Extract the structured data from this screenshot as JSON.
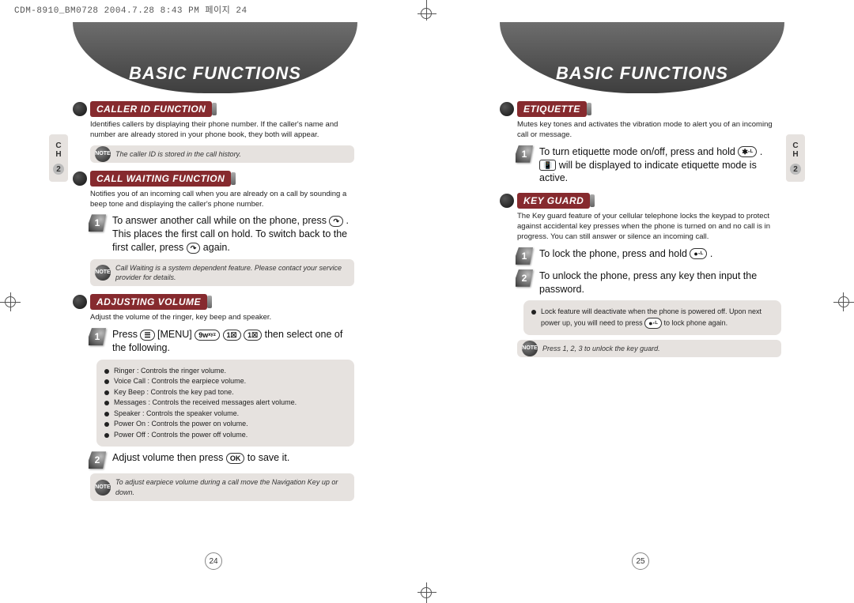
{
  "meta_header": "CDM-8910_BM0728  2004.7.28 8:43 PM 페이지 24",
  "banner_title": "BASIC FUNCTIONS",
  "sidebar": {
    "ch": "C\nH",
    "chapter": "2"
  },
  "pages": {
    "left": "24",
    "right": "25"
  },
  "left": {
    "caller_id": {
      "title": "CALLER ID FUNCTION",
      "desc": "Identifies callers by displaying their phone number. If the caller's name and number are already stored in your phone book, they both will appear.",
      "note": "The caller ID is stored in the call history."
    },
    "call_waiting": {
      "title": "CALL WAITING FUNCTION",
      "desc": "Notifies you of an incoming call when you are already on a call by sounding a beep tone and displaying the caller's phone number.",
      "step1_a": "To answer another call while on the phone, press ",
      "step1_b": " . This places the first call on hold. To switch back to the first caller, press ",
      "step1_c": " again.",
      "note": "Call Waiting is a system dependent feature. Please contact your service provider for details."
    },
    "adjusting_volume": {
      "title": "ADJUSTING VOLUME",
      "desc": "Adjust the volume of the ringer, key beep and speaker.",
      "step1_a": "Press ",
      "step1_b": " [MENU] ",
      "step1_c": " then select one of the following.",
      "bullets": [
        "Ringer : Controls the ringer volume.",
        "Voice Call : Controls the earpiece volume.",
        "Key Beep : Controls the key pad tone.",
        "Messages : Controls the received messages alert volume.",
        "Speaker : Controls the speaker volume.",
        "Power On : Controls the power on volume.",
        "Power Off : Controls the power off volume."
      ],
      "step2_a": "Adjust volume then press ",
      "step2_b": " to save it.",
      "note": "To adjust earpiece volume during a call move the Navigation Key up or down."
    }
  },
  "right": {
    "etiquette": {
      "title": "ETIQUETTE",
      "desc": "Mutes key tones and activates the vibration mode to alert you of an incoming call or message.",
      "step1_a": "To turn etiquette mode on/off, press and hold ",
      "step1_b": " .",
      "step1_c": " will be displayed to indicate etiquette mode is active."
    },
    "key_guard": {
      "title": "KEY GUARD",
      "desc": "The Key guard feature of your cellular telephone locks the keypad to protect against accidental key presses when the phone is turned on and no call is in progress. You can still answer or silence an incoming call.",
      "step1_a": "To lock the phone, press and hold ",
      "step1_b": " .",
      "step2": "To unlock the phone, press any key then input the password.",
      "box_a": "Lock feature will deactivate when the phone is powered off. Upon next power up, you will need to press ",
      "box_b": " to lock phone again.",
      "note": "Press 1, 2, 3 to unlock the key guard."
    }
  },
  "keys": {
    "send": "↷",
    "menu": "☰",
    "nine": "9ᴡˣʸᶻ",
    "one": "1☒",
    "ok": "OK",
    "star": "✱·ᴸ",
    "vib": "📳",
    "lock": "●·ᴸ"
  }
}
